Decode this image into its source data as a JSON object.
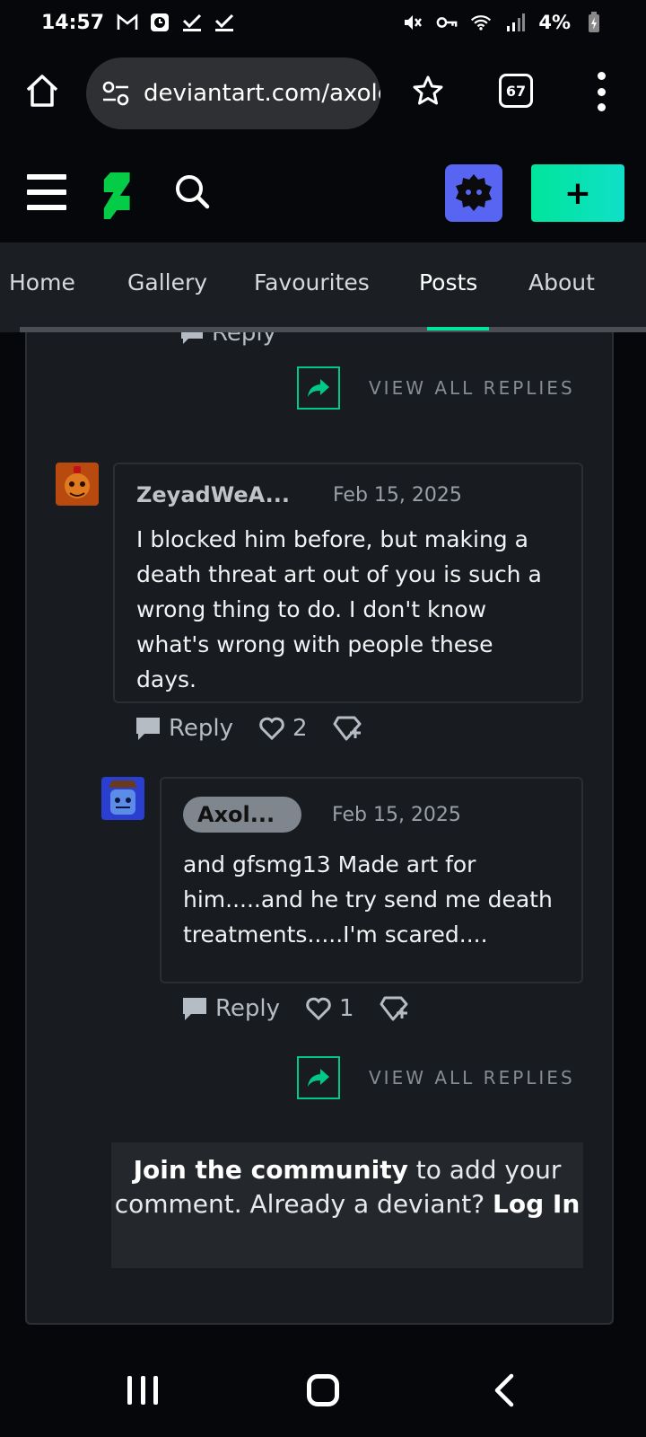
{
  "status_bar": {
    "time": "14:57",
    "battery": "4%"
  },
  "browser": {
    "url": "deviantart.com/axolo",
    "tab_count": "67"
  },
  "site_header": {
    "create_label": "+"
  },
  "profile_tabs": [
    {
      "label": "Home"
    },
    {
      "label": "Gallery"
    },
    {
      "label": "Favourites"
    },
    {
      "label": "Posts",
      "active": true
    },
    {
      "label": "About"
    }
  ],
  "thread": {
    "top_reply_label": "Reply",
    "view_all_replies_top": "VIEW ALL REPLIES",
    "comment1": {
      "username": "ZeyadWeA...",
      "date": "Feb 15, 2025",
      "text": "I blocked him before, but making a death threat art out of you is such a wrong thing to do. I don't know what's wrong with people these days.",
      "reply_label": "Reply",
      "likes": "2"
    },
    "comment2": {
      "username": "Axol...",
      "date": "Feb 15, 2025",
      "text": "and gfsmg13 Made art for him.....and he try send me death treatments.....I'm scared....",
      "reply_label": "Reply",
      "likes": "1"
    },
    "view_all_replies_bottom": "VIEW ALL REPLIES"
  },
  "join_box": {
    "bold1": "Join the community",
    "text1": " to add your comment. Already a deviant? ",
    "bold2": "Log In"
  },
  "colors": {
    "accent": "#00e59b",
    "background": "#06070a",
    "card": "#181b1f"
  }
}
